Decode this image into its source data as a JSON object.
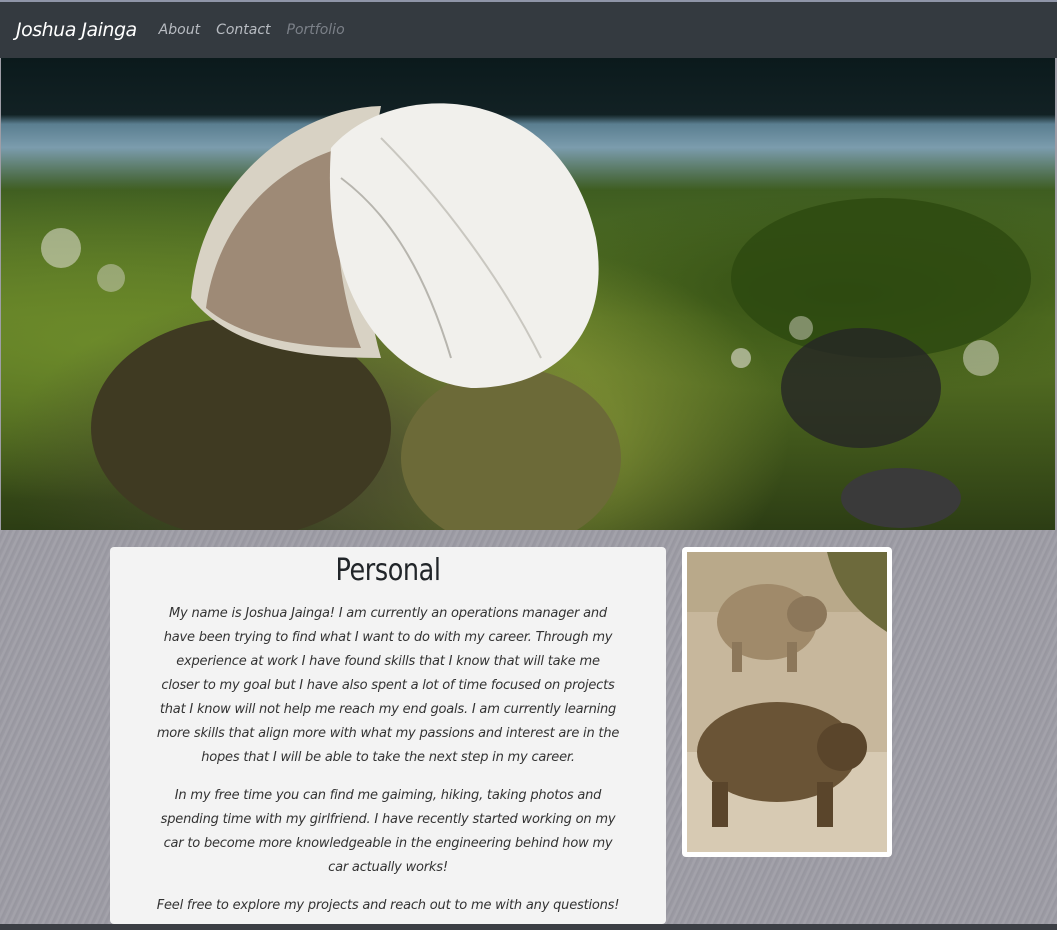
{
  "navbar": {
    "brand": "Joshua Jainga",
    "links": [
      {
        "label": "About",
        "active": false
      },
      {
        "label": "Contact",
        "active": false
      },
      {
        "label": "Portfolio",
        "active": true
      }
    ]
  },
  "hero": {
    "icon": "seashell-on-rocks-photo"
  },
  "personal": {
    "title": "Personal",
    "paragraphs": [
      "My name is Joshua Jainga! I am currently an operations manager and have been trying to find what I want to do with my career. Through my experience at work I have found skills that I know that will take me closer to my goal but I have also spent a lot of time focused on projects that I know will not help me reach my end goals. I am currently learning more skills that align more with what my passions and interest are in the hopes that I will be able to take the next step in my career.",
      "In my free time you can find me gaiming, hiking, taking photos and spending time with my girlfriend. I have recently started working on my car to become more knowledgeable in the engineering behind how my car actually works!",
      "Feel free to explore my projects and reach out to me with any questions!"
    ]
  },
  "photo": {
    "icon": "bears-photo"
  },
  "colors": {
    "navbar_bg": "#343a40",
    "card_bg": "#f3f3f3",
    "page_bg": "#9d9ca5"
  }
}
